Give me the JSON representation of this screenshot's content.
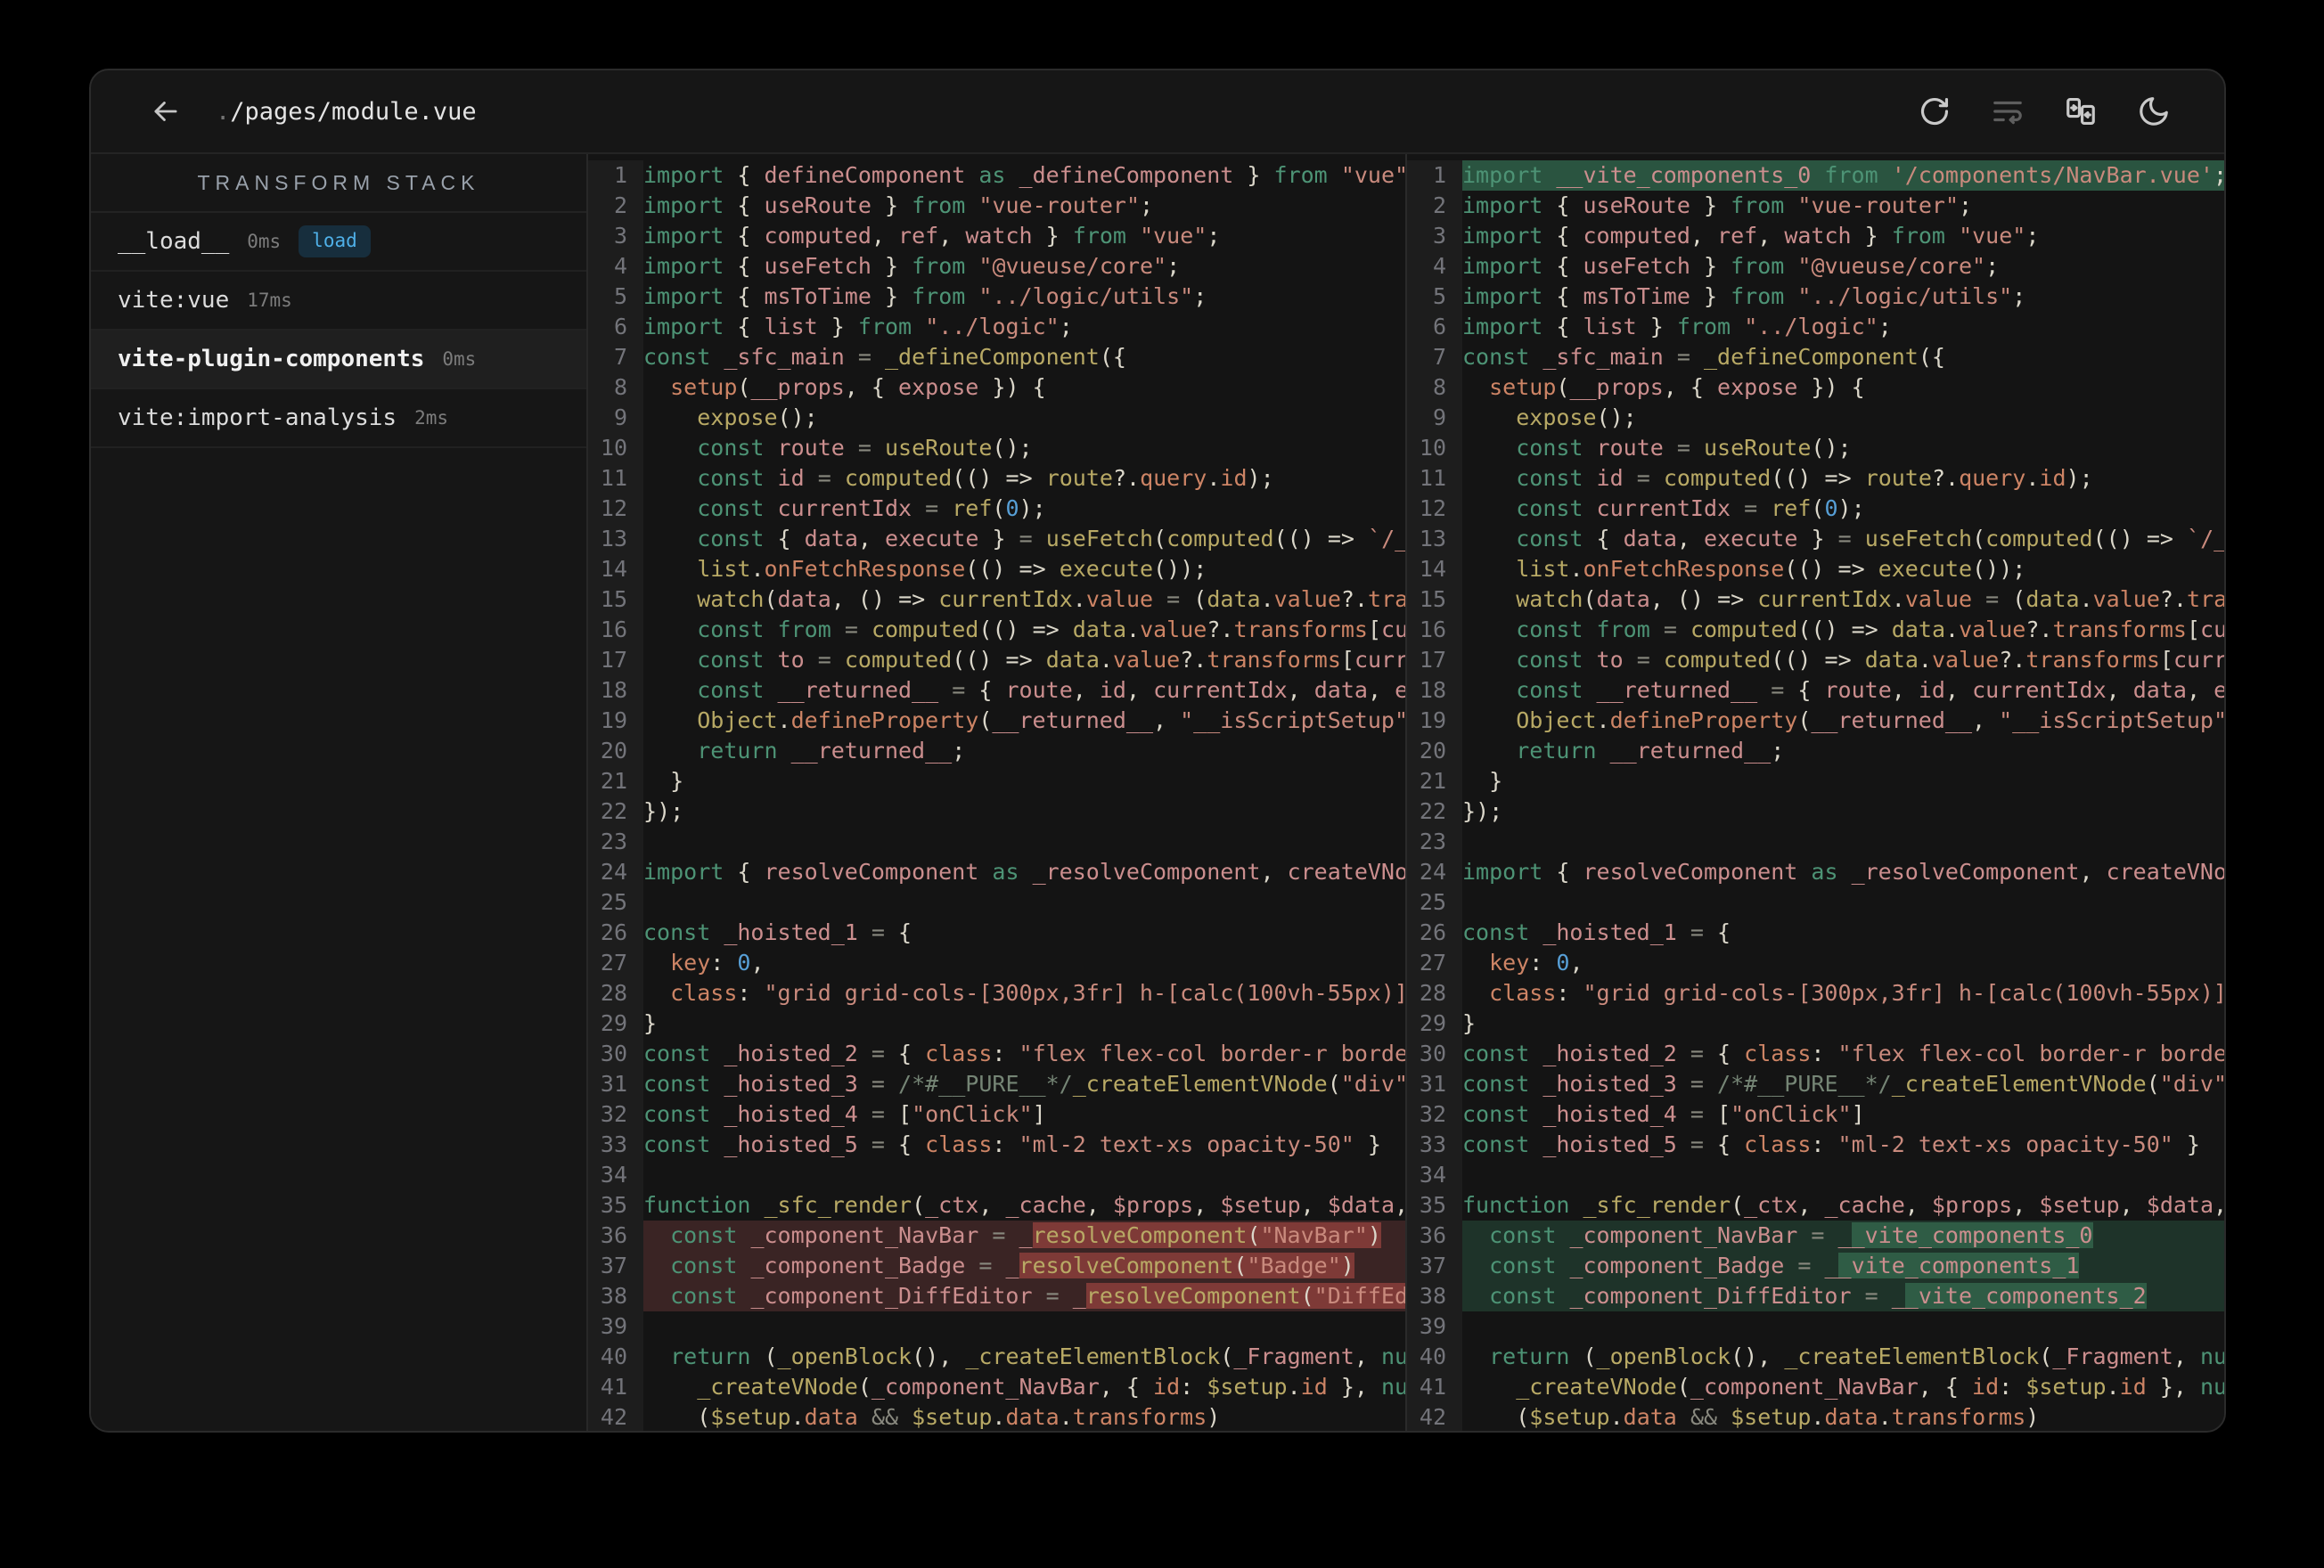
{
  "window": {
    "title_prefix": ".",
    "title_path": "/pages/module.vue"
  },
  "topbar": {
    "icons": [
      {
        "name": "refresh"
      },
      {
        "name": "word-wrap"
      },
      {
        "name": "inline-diff"
      },
      {
        "name": "dark-mode-moon"
      }
    ]
  },
  "sidebar": {
    "header": "TRANSFORM STACK",
    "items": [
      {
        "name": "__load__",
        "time": "0ms",
        "badge": "load",
        "selected": false
      },
      {
        "name": "vite:vue",
        "time": "17ms",
        "selected": false
      },
      {
        "name": "vite-plugin-components",
        "time": "0ms",
        "selected": true
      },
      {
        "name": "vite:import-analysis",
        "time": "2ms",
        "selected": false
      }
    ]
  },
  "colors": {
    "badge_text": "#4FB0E8",
    "diff_del_line": "#3A2424",
    "diff_del_word": "#7E3A37",
    "diff_add_line": "#1E3329",
    "diff_add_word": "#2F5C45",
    "diff_add_full": "#2A5440"
  },
  "editor": {
    "before": {
      "lines": [
        {
          "n": 1,
          "t": "import { defineComponent as _defineComponent } from \"vue\";"
        },
        {
          "n": 2,
          "t": "import { useRoute } from \"vue-router\";"
        },
        {
          "n": 3,
          "t": "import { computed, ref, watch } from \"vue\";"
        },
        {
          "n": 4,
          "t": "import { useFetch } from \"@vueuse/core\";"
        },
        {
          "n": 5,
          "t": "import { msToTime } from \"../logic/utils\";"
        },
        {
          "n": 6,
          "t": "import { list } from \"../logic\";"
        },
        {
          "n": 7,
          "t": "const _sfc_main = _defineComponent({"
        },
        {
          "n": 8,
          "t": "  setup(__props, { expose }) {"
        },
        {
          "n": 9,
          "t": "    expose();"
        },
        {
          "n": 10,
          "t": "    const route = useRoute();"
        },
        {
          "n": 11,
          "t": "    const id = computed(() => route?.query.id);"
        },
        {
          "n": 12,
          "t": "    const currentIdx = ref(0);"
        },
        {
          "n": 13,
          "t": "    const { data, execute } = useFetch(computed(() => `/_"
        },
        {
          "n": 14,
          "t": "    list.onFetchResponse(() => execute());"
        },
        {
          "n": 15,
          "t": "    watch(data, () => currentIdx.value = (data.value?.tra"
        },
        {
          "n": 16,
          "t": "    const from = computed(() => data.value?.transforms[cu"
        },
        {
          "n": 17,
          "t": "    const to = computed(() => data.value?.transforms[curr"
        },
        {
          "n": 18,
          "t": "    const __returned__ = { route, id, currentIdx, data, e"
        },
        {
          "n": 19,
          "t": "    Object.defineProperty(__returned__, \"__isScriptSetup\""
        },
        {
          "n": 20,
          "t": "    return __returned__;"
        },
        {
          "n": 21,
          "t": "  }"
        },
        {
          "n": 22,
          "t": "});"
        },
        {
          "n": 23,
          "t": ""
        },
        {
          "n": 24,
          "t": "import { resolveComponent as _resolveComponent, createVNo"
        },
        {
          "n": 25,
          "t": ""
        },
        {
          "n": 26,
          "t": "const _hoisted_1 = {"
        },
        {
          "n": 27,
          "t": "  key: 0,"
        },
        {
          "n": 28,
          "t": "  class: \"grid grid-cols-[300px,3fr] h-[calc(100vh-55px)]"
        },
        {
          "n": 29,
          "t": "}"
        },
        {
          "n": 30,
          "t": "const _hoisted_2 = { class: \"flex flex-col border-r borde"
        },
        {
          "n": 31,
          "t": "const _hoisted_3 = /*#__PURE__*/_createElementVNode(\"div\""
        },
        {
          "n": 32,
          "t": "const _hoisted_4 = [\"onClick\"]"
        },
        {
          "n": 33,
          "t": "const _hoisted_5 = { class: \"ml-2 text-xs opacity-50\" }"
        },
        {
          "n": 34,
          "t": ""
        },
        {
          "n": 35,
          "t": "function _sfc_render(_ctx, _cache, $props, $setup, $data,"
        },
        {
          "n": 36,
          "t": "  const _component_NavBar = _resolveComponent(\"NavBar\")",
          "m": "del",
          "h": [
            29,
            55
          ]
        },
        {
          "n": 37,
          "t": "  const _component_Badge = _resolveComponent(\"Badge\")",
          "m": "del",
          "h": [
            28,
            53
          ]
        },
        {
          "n": 38,
          "t": "  const _component_DiffEditor = _resolveComponent(\"DiffEd",
          "m": "del",
          "h": [
            33,
            57
          ]
        },
        {
          "n": 39,
          "t": ""
        },
        {
          "n": 40,
          "t": "  return (_openBlock(), _createElementBlock(_Fragment, nu"
        },
        {
          "n": 41,
          "t": "    _createVNode(_component_NavBar, { id: $setup.id }, nu"
        },
        {
          "n": 42,
          "t": "    ($setup.data && $setup.data.transforms)"
        }
      ]
    },
    "after": {
      "lines": [
        {
          "n": 1,
          "t": "import __vite_components_0 from '/components/NavBar.vue';",
          "m": "addfull"
        },
        {
          "n": 2,
          "t": "import { useRoute } from \"vue-router\";"
        },
        {
          "n": 3,
          "t": "import { computed, ref, watch } from \"vue\";"
        },
        {
          "n": 4,
          "t": "import { useFetch } from \"@vueuse/core\";"
        },
        {
          "n": 5,
          "t": "import { msToTime } from \"../logic/utils\";"
        },
        {
          "n": 6,
          "t": "import { list } from \"../logic\";"
        },
        {
          "n": 7,
          "t": "const _sfc_main = _defineComponent({"
        },
        {
          "n": 8,
          "t": "  setup(__props, { expose }) {"
        },
        {
          "n": 9,
          "t": "    expose();"
        },
        {
          "n": 10,
          "t": "    const route = useRoute();"
        },
        {
          "n": 11,
          "t": "    const id = computed(() => route?.query.id);"
        },
        {
          "n": 12,
          "t": "    const currentIdx = ref(0);"
        },
        {
          "n": 13,
          "t": "    const { data, execute } = useFetch(computed(() => `/_"
        },
        {
          "n": 14,
          "t": "    list.onFetchResponse(() => execute());"
        },
        {
          "n": 15,
          "t": "    watch(data, () => currentIdx.value = (data.value?.tra"
        },
        {
          "n": 16,
          "t": "    const from = computed(() => data.value?.transforms[cu"
        },
        {
          "n": 17,
          "t": "    const to = computed(() => data.value?.transforms[curr"
        },
        {
          "n": 18,
          "t": "    const __returned__ = { route, id, currentIdx, data, e"
        },
        {
          "n": 19,
          "t": "    Object.defineProperty(__returned__, \"__isScriptSetup\""
        },
        {
          "n": 20,
          "t": "    return __returned__;"
        },
        {
          "n": 21,
          "t": "  }"
        },
        {
          "n": 22,
          "t": "});"
        },
        {
          "n": 23,
          "t": ""
        },
        {
          "n": 24,
          "t": "import { resolveComponent as _resolveComponent, createVNo"
        },
        {
          "n": 25,
          "t": ""
        },
        {
          "n": 26,
          "t": "const _hoisted_1 = {"
        },
        {
          "n": 27,
          "t": "  key: 0,"
        },
        {
          "n": 28,
          "t": "  class: \"grid grid-cols-[300px,3fr] h-[calc(100vh-55px)]"
        },
        {
          "n": 29,
          "t": "}"
        },
        {
          "n": 30,
          "t": "const _hoisted_2 = { class: \"flex flex-col border-r borde"
        },
        {
          "n": 31,
          "t": "const _hoisted_3 = /*#__PURE__*/_createElementVNode(\"div\""
        },
        {
          "n": 32,
          "t": "const _hoisted_4 = [\"onClick\"]"
        },
        {
          "n": 33,
          "t": "const _hoisted_5 = { class: \"ml-2 text-xs opacity-50\" }"
        },
        {
          "n": 34,
          "t": ""
        },
        {
          "n": 35,
          "t": "function _sfc_render(_ctx, _cache, $props, $setup, $data,"
        },
        {
          "n": 36,
          "t": "  const _component_NavBar = __vite_components_0",
          "m": "add",
          "h": [
            29,
            47
          ]
        },
        {
          "n": 37,
          "t": "  const _component_Badge = __vite_components_1",
          "m": "add",
          "h": [
            28,
            46
          ]
        },
        {
          "n": 38,
          "t": "  const _component_DiffEditor = __vite_components_2",
          "m": "add",
          "h": [
            33,
            51
          ]
        },
        {
          "n": 39,
          "t": ""
        },
        {
          "n": 40,
          "t": "  return (_openBlock(), _createElementBlock(_Fragment, nu"
        },
        {
          "n": 41,
          "t": "    _createVNode(_component_NavBar, { id: $setup.id }, nu"
        },
        {
          "n": 42,
          "t": "    ($setup.data && $setup.data.transforms)"
        }
      ]
    }
  }
}
